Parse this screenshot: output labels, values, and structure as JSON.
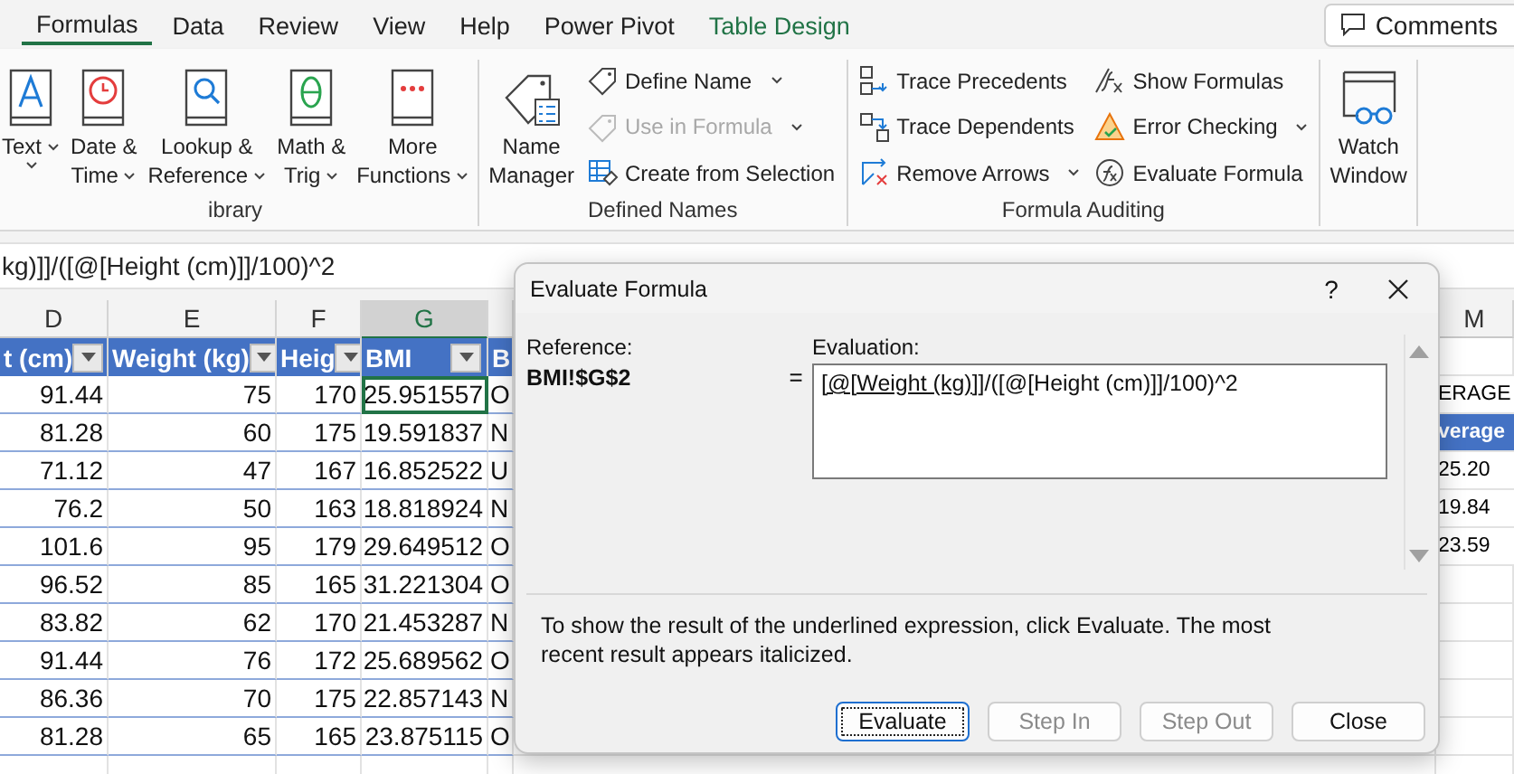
{
  "ribbon_tabs": [
    {
      "label": "Formulas",
      "selected": true,
      "kind": "normal"
    },
    {
      "label": "Data",
      "selected": false,
      "kind": "normal"
    },
    {
      "label": "Review",
      "selected": false,
      "kind": "normal"
    },
    {
      "label": "View",
      "selected": false,
      "kind": "normal"
    },
    {
      "label": "Help",
      "selected": false,
      "kind": "normal"
    },
    {
      "label": "Power Pivot",
      "selected": false,
      "kind": "normal"
    },
    {
      "label": "Table Design",
      "selected": false,
      "kind": "contextual"
    }
  ],
  "comments_button": "Comments",
  "ribbon_groups": [
    {
      "label": "ibrary",
      "columns": [
        {
          "kind": "big",
          "lines": [
            "Text"
          ],
          "dropdown": true
        },
        {
          "kind": "big",
          "lines": [
            "Date &",
            "Time"
          ],
          "dropdown": true
        },
        {
          "kind": "big",
          "lines": [
            "Lookup &",
            "Reference"
          ],
          "dropdown": true
        },
        {
          "kind": "big",
          "lines": [
            "Math &",
            "Trig"
          ],
          "dropdown": true
        },
        {
          "kind": "big",
          "lines": [
            "More",
            "Functions"
          ],
          "dropdown": true
        }
      ]
    },
    {
      "label": "Defined Names",
      "columns": [
        {
          "kind": "big",
          "lines": [
            "Name",
            "Manager"
          ],
          "dropdown": false
        },
        {
          "kind": "stack",
          "items": [
            {
              "label": "Define Name",
              "dropdown": true,
              "disabled": false
            },
            {
              "label": "Use in Formula",
              "dropdown": true,
              "disabled": true
            },
            {
              "label": "Create from Selection",
              "dropdown": false,
              "disabled": false
            }
          ]
        }
      ]
    },
    {
      "label": "Formula Auditing",
      "columns": [
        {
          "kind": "stack",
          "items": [
            {
              "label": "Trace Precedents",
              "dropdown": false,
              "disabled": false
            },
            {
              "label": "Trace Dependents",
              "dropdown": false,
              "disabled": false
            },
            {
              "label": "Remove Arrows",
              "dropdown": true,
              "disabled": false
            }
          ]
        },
        {
          "kind": "stack",
          "items": [
            {
              "label": "Show Formulas",
              "dropdown": false,
              "disabled": false
            },
            {
              "label": "Error Checking",
              "dropdown": true,
              "disabled": false
            },
            {
              "label": "Evaluate Formula",
              "dropdown": false,
              "disabled": false
            }
          ]
        }
      ]
    },
    {
      "columns": [
        {
          "kind": "big",
          "lines": [
            "Watch",
            "Window"
          ],
          "dropdown": false
        }
      ]
    }
  ],
  "formula_bar": {
    "text": "kg)]]/([@[Height (cm)]]/100)^2"
  },
  "sheet": {
    "columns": [
      {
        "label": "D",
        "selected": false
      },
      {
        "label": "E",
        "selected": false
      },
      {
        "label": "F",
        "selected": false
      },
      {
        "label": "G",
        "selected": true
      }
    ],
    "header_row": [
      "t (cm)",
      "Weight (kg)",
      "Heig",
      "BMI",
      "B"
    ],
    "rows": [
      {
        "cells": [
          {
            "text": "91.44",
            "selected": false
          },
          {
            "text": "75",
            "selected": false
          },
          {
            "text": "170",
            "selected": false
          },
          {
            "text": "25.951557",
            "selected": true
          },
          {
            "text": "O",
            "selected": false
          }
        ]
      },
      {
        "cells": [
          {
            "text": "81.28",
            "selected": false
          },
          {
            "text": "60",
            "selected": false
          },
          {
            "text": "175",
            "selected": false
          },
          {
            "text": "19.591837",
            "selected": false
          },
          {
            "text": "N",
            "selected": false
          }
        ]
      },
      {
        "cells": [
          {
            "text": "71.12",
            "selected": false
          },
          {
            "text": "47",
            "selected": false
          },
          {
            "text": "167",
            "selected": false
          },
          {
            "text": "16.852522",
            "selected": false
          },
          {
            "text": "U",
            "selected": false
          }
        ]
      },
      {
        "cells": [
          {
            "text": "76.2",
            "selected": false
          },
          {
            "text": "50",
            "selected": false
          },
          {
            "text": "163",
            "selected": false
          },
          {
            "text": "18.818924",
            "selected": false
          },
          {
            "text": "N",
            "selected": false
          }
        ]
      },
      {
        "cells": [
          {
            "text": "101.6",
            "selected": false
          },
          {
            "text": "95",
            "selected": false
          },
          {
            "text": "179",
            "selected": false
          },
          {
            "text": "29.649512",
            "selected": false
          },
          {
            "text": "O",
            "selected": false
          }
        ]
      },
      {
        "cells": [
          {
            "text": "96.52",
            "selected": false
          },
          {
            "text": "85",
            "selected": false
          },
          {
            "text": "165",
            "selected": false
          },
          {
            "text": "31.221304",
            "selected": false
          },
          {
            "text": "O",
            "selected": false
          }
        ]
      },
      {
        "cells": [
          {
            "text": "83.82",
            "selected": false
          },
          {
            "text": "62",
            "selected": false
          },
          {
            "text": "170",
            "selected": false
          },
          {
            "text": "21.453287",
            "selected": false
          },
          {
            "text": "N",
            "selected": false
          }
        ]
      },
      {
        "cells": [
          {
            "text": "91.44",
            "selected": false
          },
          {
            "text": "76",
            "selected": false
          },
          {
            "text": "172",
            "selected": false
          },
          {
            "text": "25.689562",
            "selected": false
          },
          {
            "text": "O",
            "selected": false
          }
        ]
      },
      {
        "cells": [
          {
            "text": "86.36",
            "selected": false
          },
          {
            "text": "70",
            "selected": false
          },
          {
            "text": "175",
            "selected": false
          },
          {
            "text": "22.857143",
            "selected": false
          },
          {
            "text": "N",
            "selected": false
          }
        ]
      },
      {
        "cells": [
          {
            "text": "81.28",
            "selected": false
          },
          {
            "text": "65",
            "selected": false
          },
          {
            "text": "165",
            "selected": false
          },
          {
            "text": "23.875115",
            "selected": false
          },
          {
            "text": "O",
            "selected": false
          }
        ]
      }
    ],
    "side_column": {
      "label": "M",
      "cells": [
        {
          "text": "ERAGE",
          "kind": "plain"
        },
        {
          "text": "verage",
          "kind": "header"
        },
        {
          "text": "25.20",
          "kind": "value"
        },
        {
          "text": "19.84",
          "kind": "value"
        },
        {
          "text": "23.59",
          "kind": "value"
        }
      ]
    }
  },
  "dialog": {
    "title": "Evaluate Formula",
    "help": "?",
    "reference_label": "Reference:",
    "reference": "BMI!$G$2",
    "equals": "=",
    "evaluation_label": "Evaluation:",
    "expression": [
      {
        "text": "[@[Weight (kg)]]",
        "underlined": true
      },
      {
        "text": "/([@[Height (cm)]]/100)^2",
        "underlined": false
      }
    ],
    "hint": "To show the result of the underlined expression, click Evaluate.  The most recent result appears italicized.",
    "buttons": [
      {
        "label": "Evaluate",
        "disabled": false,
        "focused": true
      },
      {
        "label": "Step In",
        "disabled": true,
        "focused": false
      },
      {
        "label": "Step Out",
        "disabled": true,
        "focused": false
      },
      {
        "label": "Close",
        "disabled": false,
        "focused": false
      }
    ]
  }
}
